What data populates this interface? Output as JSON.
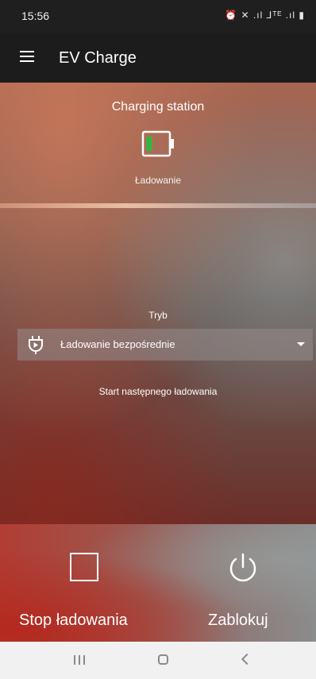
{
  "status_bar": {
    "time": "15:56",
    "icons": "⏰ ✕ .ıl ⅃ᵀᴱ .ıl ▮"
  },
  "app_bar": {
    "title": "EV Charge",
    "menu_icon": "hamburger-icon"
  },
  "station": {
    "title": "Charging station",
    "status": "Ładowanie",
    "battery_color": "#3cb043"
  },
  "mode": {
    "label": "Tryb",
    "selected": "Ładowanie bezpośrednie",
    "icon": "plug-icon"
  },
  "next_charge": {
    "label": "Start następnego ładowania"
  },
  "actions": {
    "stop_label": "Stop ładowania",
    "lock_label": "Zablokuj"
  },
  "nav": {
    "recents": "recents-icon",
    "home": "home-icon",
    "back": "back-icon"
  }
}
